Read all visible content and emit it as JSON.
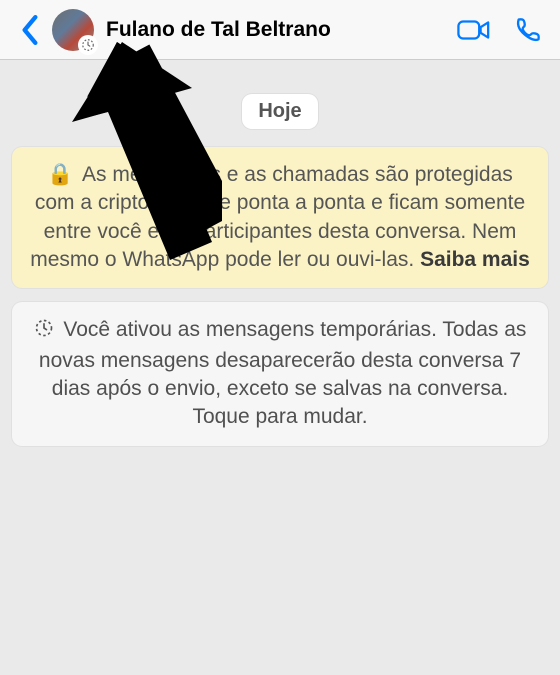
{
  "header": {
    "contact_name": "Fulano de Tal Beltrano"
  },
  "chat": {
    "date_label": "Hoje",
    "encryption_notice": "As mensagens e as chamadas são protegidas com a criptografia de ponta a ponta e ficam somente entre você e os participantes desta conversa. Nem mesmo o WhatsApp pode ler ou ouvi-las. ",
    "encryption_cta": "Saiba mais",
    "disappearing_notice": "Você ativou as mensagens temporárias. Todas as novas mensagens desaparecerão desta conversa 7 dias após o envio, exceto se salvas na conversa. Toque para mudar."
  },
  "colors": {
    "accent": "#007aff"
  }
}
